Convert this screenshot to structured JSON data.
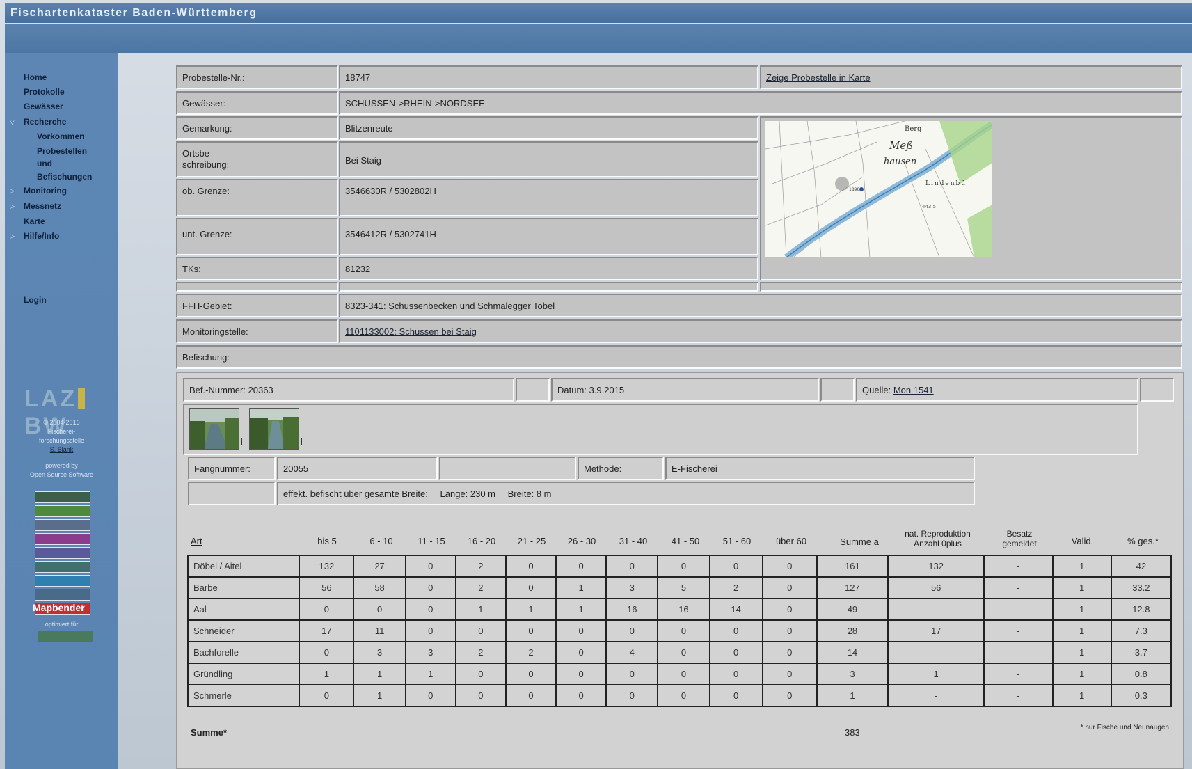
{
  "app": {
    "title": "Fischartenkataster Baden-Württemberg"
  },
  "nav": {
    "items": [
      {
        "label": "Home"
      },
      {
        "label": "Protokolle"
      },
      {
        "label": "Gewässer"
      },
      {
        "label": "Recherche"
      },
      {
        "label": "Vorkommen"
      },
      {
        "label": "Probestellen"
      },
      {
        "label": "und"
      },
      {
        "label": "Befischungen"
      },
      {
        "label": "Monitoring"
      },
      {
        "label": "Messnetz"
      },
      {
        "label": "Karte"
      },
      {
        "label": "Hilfe/Info"
      }
    ],
    "login": "Login"
  },
  "sidebar": {
    "logo_left": "LAZ",
    "logo_right": "BW",
    "copyright": "© 2004-2016",
    "org_line1": "Fischerei-",
    "org_line2": "forschungsstelle",
    "org_link": "S. Blank",
    "powered_by": "powered by",
    "oss": "Open Source Software",
    "mapbender": "Mapbender",
    "optimized": "optimiert für"
  },
  "info": {
    "probestelle_label": "Probestelle-Nr.:",
    "probestelle_value": "18747",
    "map_link": "Zeige Probestelle in Karte",
    "gewaesser_label": "Gewässer:",
    "gewaesser_value": "SCHUSSEN->RHEIN->NORDSEE",
    "gemarkung_label": "Gemarkung:",
    "gemarkung_value": "Blitzenreute",
    "ortsbe_label_1": "Ortsbe-",
    "ortsbe_label_2": "schreibung:",
    "ortsbe_value": "Bei Staig",
    "ob_label": "ob. Grenze:",
    "ob_value": "3546630R / 5302802H",
    "unt_label": "unt. Grenze:",
    "unt_value": "3546412R / 5302741H",
    "tks_label": "TKs:",
    "tks_value": "81232",
    "ffh_label": "FFH-Gebiet:",
    "ffh_value": "8323-341: Schussenbecken und Schmalegger Tobel",
    "monitoring_label": "Monitoringstelle:",
    "monitoring_value": "1101133002: Schussen bei Staig",
    "befischung_label": "Befischung:",
    "map_text": {
      "berg": "Berg",
      "mess": "Meß",
      "hausen": "hausen",
      "lindenb": "Lindenbü",
      "alt": "443.5",
      "num": "1890"
    }
  },
  "befischung": {
    "befnr": "Bef.-Nummer: 20363",
    "datum": "Datum: 3.9.2015",
    "quelle_label": "Quelle:",
    "quelle_link": "Mon 1541",
    "fangnummer_label": "Fangnummer:",
    "fangnummer_value": "20055",
    "methode_label": "Methode:",
    "methode_value": "E-Fischerei",
    "effekt": "effekt. befischt über gesamte Breite:",
    "laenge": "Länge: 230 m",
    "breite": "Breite: 8 m"
  },
  "table": {
    "headers": {
      "art": "Art",
      "c1": "bis 5",
      "c2": "6 - 10",
      "c3": "11 - 15",
      "c4": "16 - 20",
      "c5": "21 - 25",
      "c6": "26 - 30",
      "c7": "31 - 40",
      "c8": "41 - 50",
      "c9": "51 - 60",
      "c10": "über 60",
      "summe": "Summe ä",
      "nat1": "nat. Reproduktion",
      "nat2": "Anzahl 0plus",
      "besatz1": "Besatz",
      "besatz2": "gemeldet",
      "valid": "Valid.",
      "pct": "% ges.*"
    },
    "rows": [
      [
        "Döbel / Aitel",
        "132",
        "27",
        "0",
        "2",
        "0",
        "0",
        "0",
        "0",
        "0",
        "0",
        "161",
        "132",
        "-",
        "1",
        "42"
      ],
      [
        "Barbe",
        "56",
        "58",
        "0",
        "2",
        "0",
        "1",
        "3",
        "5",
        "2",
        "0",
        "127",
        "56",
        "-",
        "1",
        "33.2"
      ],
      [
        "Aal",
        "0",
        "0",
        "0",
        "1",
        "1",
        "1",
        "16",
        "16",
        "14",
        "0",
        "49",
        "-",
        "-",
        "1",
        "12.8"
      ],
      [
        "Schneider",
        "17",
        "11",
        "0",
        "0",
        "0",
        "0",
        "0",
        "0",
        "0",
        "0",
        "28",
        "17",
        "-",
        "1",
        "7.3"
      ],
      [
        "Bachforelle",
        "0",
        "3",
        "3",
        "2",
        "2",
        "0",
        "4",
        "0",
        "0",
        "0",
        "14",
        "-",
        "-",
        "1",
        "3.7"
      ],
      [
        "Gründling",
        "1",
        "1",
        "1",
        "0",
        "0",
        "0",
        "0",
        "0",
        "0",
        "0",
        "3",
        "1",
        "-",
        "1",
        "0.8"
      ],
      [
        "Schmerle",
        "0",
        "1",
        "0",
        "0",
        "0",
        "0",
        "0",
        "0",
        "0",
        "0",
        "1",
        "-",
        "-",
        "1",
        "0.3"
      ]
    ],
    "summe_label": "Summe*",
    "summe_value": "383",
    "footnote": "* nur Fische und Neunaugen"
  }
}
